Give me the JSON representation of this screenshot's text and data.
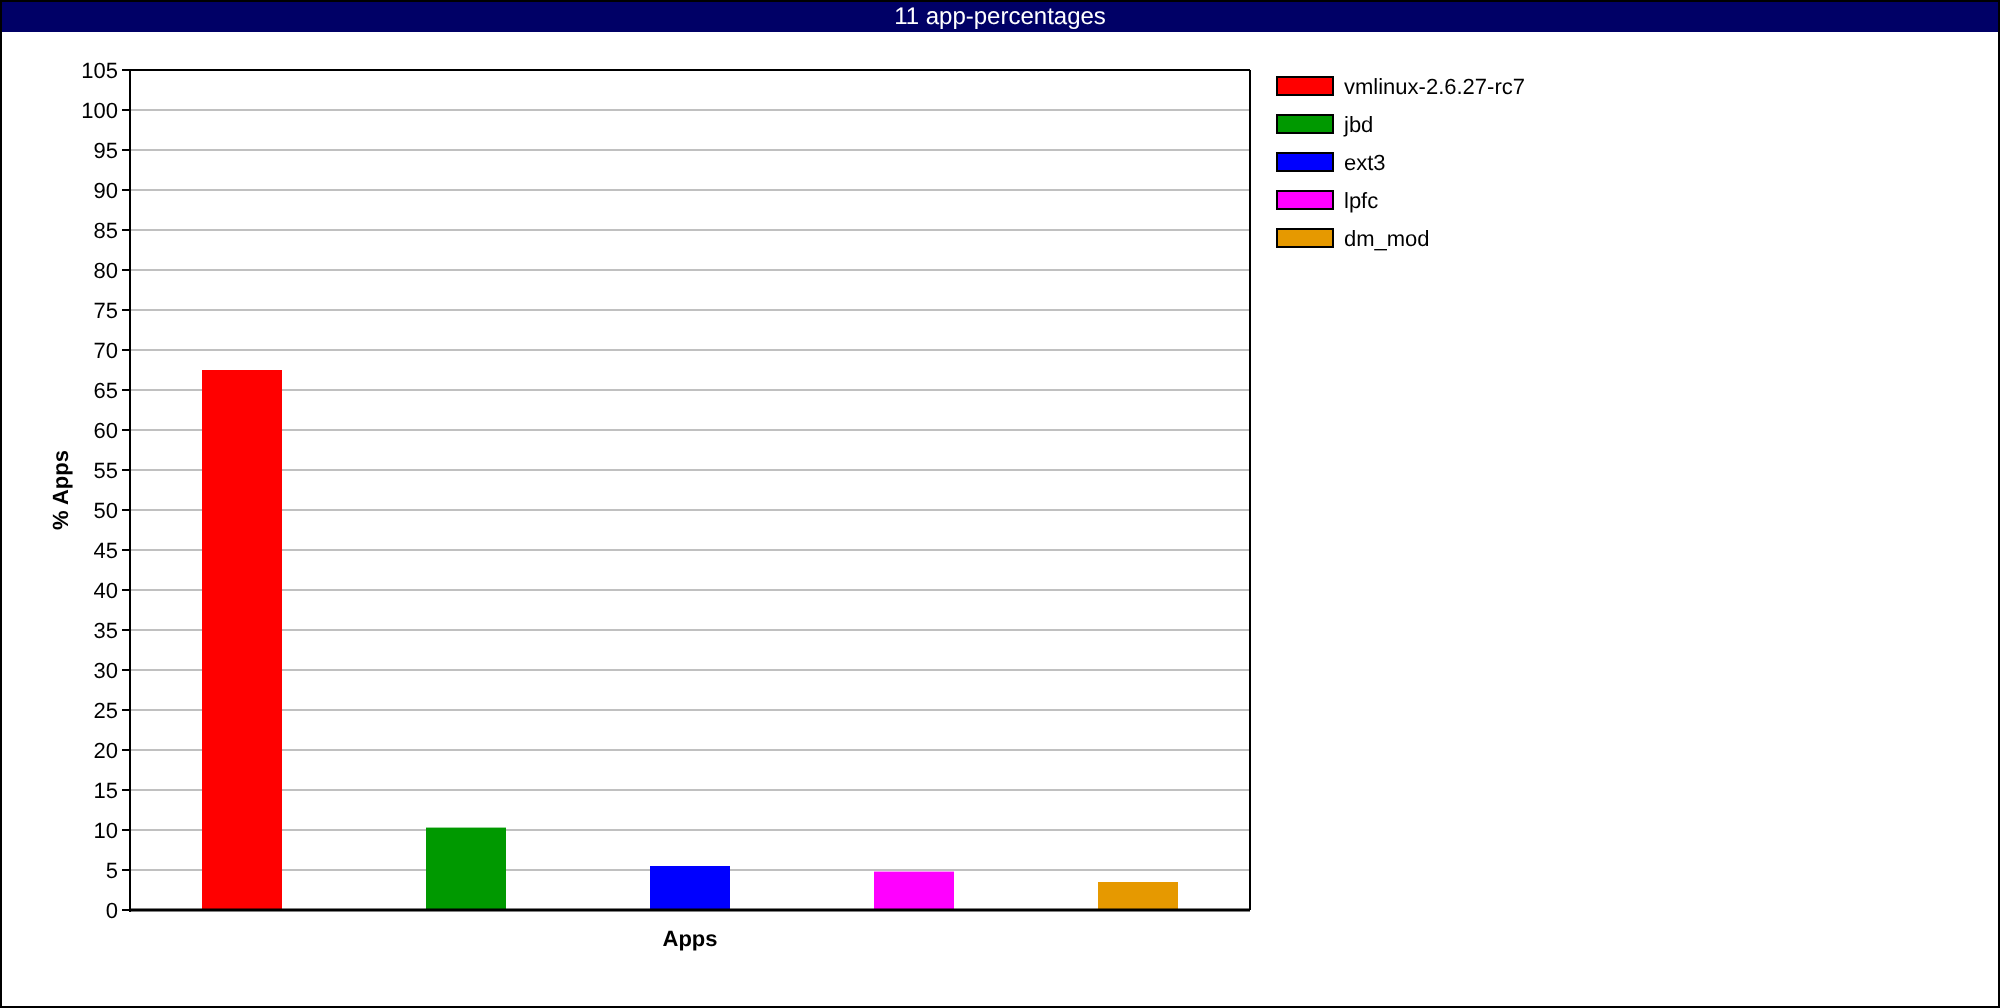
{
  "window": {
    "title": "11 app-percentages"
  },
  "chart_data": {
    "type": "bar",
    "xlabel": "Apps",
    "ylabel": "% Apps",
    "ylim": [
      0,
      105
    ],
    "grid": true,
    "legend": true,
    "yticks": [
      0,
      5,
      10,
      15,
      20,
      25,
      30,
      35,
      40,
      45,
      50,
      55,
      60,
      65,
      70,
      75,
      80,
      85,
      90,
      95,
      100,
      105
    ],
    "series": [
      {
        "name": "vmlinux-2.6.27-rc7",
        "color": "#ff0000",
        "values": [
          67.5,
          null,
          null,
          null,
          null
        ]
      },
      {
        "name": "jbd",
        "color": "#009900",
        "values": [
          null,
          10.3,
          null,
          null,
          null
        ]
      },
      {
        "name": "ext3",
        "color": "#0000ff",
        "values": [
          null,
          null,
          5.5,
          null,
          null
        ]
      },
      {
        "name": "lpfc",
        "color": "#ff00ff",
        "values": [
          null,
          null,
          null,
          4.8,
          null
        ]
      },
      {
        "name": "dm_mod",
        "color": "#e69900",
        "values": [
          null,
          null,
          null,
          null,
          3.5
        ]
      }
    ]
  }
}
